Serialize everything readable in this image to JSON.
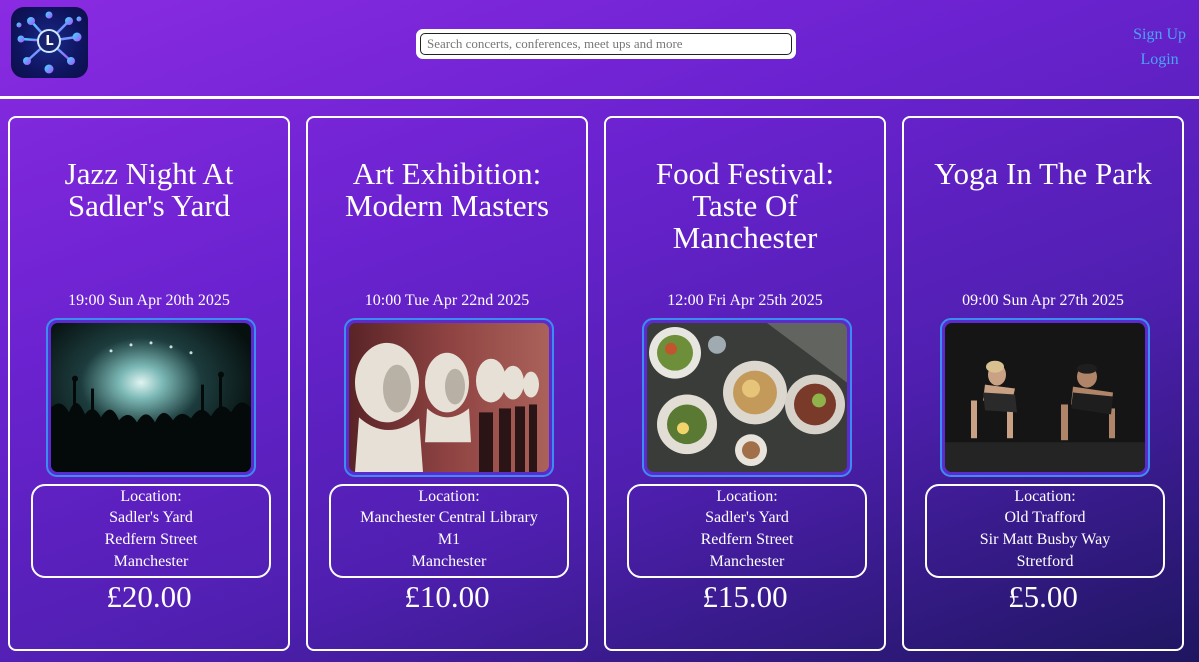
{
  "header": {
    "logo_letter": "L",
    "search_placeholder": "Search concerts, conferences, meet ups and more",
    "signup_label": "Sign Up",
    "login_label": "Login"
  },
  "events": [
    {
      "title": "Jazz Night At Sadler's Yard",
      "datetime": "19:00 Sun Apr 20th 2025",
      "location_label": "Location:",
      "location_lines": [
        "Sadler's Yard",
        "Redfern Street",
        "Manchester"
      ],
      "price": "£20.00"
    },
    {
      "title": "Art Exhibition: Modern Masters",
      "datetime": "10:00 Tue Apr 22nd 2025",
      "location_label": "Location:",
      "location_lines": [
        "Manchester Central Library",
        "M1",
        "Manchester"
      ],
      "price": "£10.00"
    },
    {
      "title": "Food Festival: Taste Of Manchester",
      "datetime": "12:00 Fri Apr 25th 2025",
      "location_label": "Location:",
      "location_lines": [
        "Sadler's Yard",
        "Redfern Street",
        "Manchester"
      ],
      "price": "£15.00"
    },
    {
      "title": "Yoga In The Park",
      "datetime": "09:00 Sun Apr 27th 2025",
      "location_label": "Location:",
      "location_lines": [
        "Old Trafford",
        "Sir Matt Busby Way",
        "Stretford"
      ],
      "price": "£5.00"
    }
  ]
}
